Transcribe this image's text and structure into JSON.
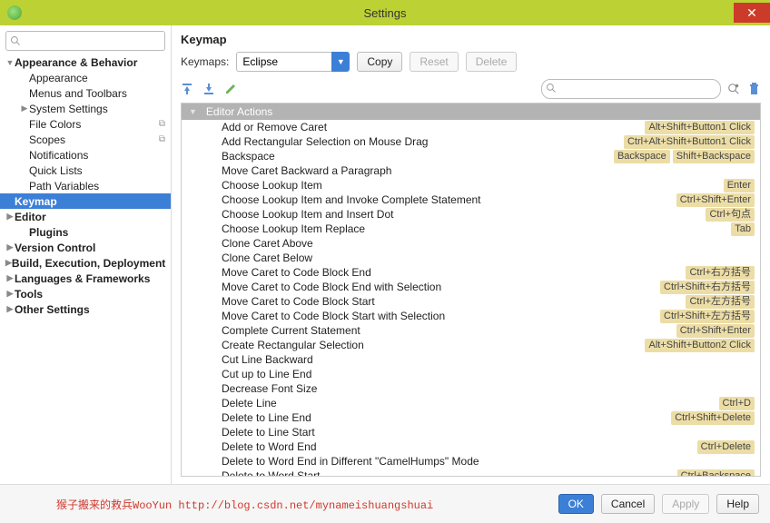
{
  "window": {
    "title": "Settings"
  },
  "sidebar": {
    "items": [
      {
        "label": "Appearance & Behavior",
        "bold": true,
        "level": 0,
        "expand": "open"
      },
      {
        "label": "Appearance",
        "level": 1
      },
      {
        "label": "Menus and Toolbars",
        "level": 1
      },
      {
        "label": "System Settings",
        "level": 1,
        "expand": "closed"
      },
      {
        "label": "File Colors",
        "level": 1,
        "mark": "⧉"
      },
      {
        "label": "Scopes",
        "level": 1,
        "mark": "⧉"
      },
      {
        "label": "Notifications",
        "level": 1
      },
      {
        "label": "Quick Lists",
        "level": 1
      },
      {
        "label": "Path Variables",
        "level": 1
      },
      {
        "label": "Keymap",
        "bold": true,
        "level": 0,
        "selected": true
      },
      {
        "label": "Editor",
        "bold": true,
        "level": 0,
        "expand": "closed"
      },
      {
        "label": "Plugins",
        "bold": true,
        "level": 1
      },
      {
        "label": "Version Control",
        "bold": true,
        "level": 0,
        "expand": "closed"
      },
      {
        "label": "Build, Execution, Deployment",
        "bold": true,
        "level": 0,
        "expand": "closed"
      },
      {
        "label": "Languages & Frameworks",
        "bold": true,
        "level": 0,
        "expand": "closed"
      },
      {
        "label": "Tools",
        "bold": true,
        "level": 0,
        "expand": "closed"
      },
      {
        "label": "Other Settings",
        "bold": true,
        "level": 0,
        "expand": "closed"
      }
    ]
  },
  "panel": {
    "title": "Keymap",
    "keymaps_label": "Keymaps:",
    "selected_keymap": "Eclipse",
    "copy_label": "Copy",
    "reset_label": "Reset",
    "delete_label": "Delete",
    "section_header": "Editor Actions",
    "actions": [
      {
        "name": "Add or Remove Caret",
        "shortcuts": [
          "Alt+Shift+Button1 Click"
        ]
      },
      {
        "name": "Add Rectangular Selection on Mouse Drag",
        "shortcuts": [
          "Ctrl+Alt+Shift+Button1 Click"
        ]
      },
      {
        "name": "Backspace",
        "shortcuts": [
          "Backspace",
          "Shift+Backspace"
        ]
      },
      {
        "name": "Move Caret Backward a Paragraph",
        "shortcuts": []
      },
      {
        "name": "Choose Lookup Item",
        "shortcuts": [
          "Enter"
        ]
      },
      {
        "name": "Choose Lookup Item and Invoke Complete Statement",
        "shortcuts": [
          "Ctrl+Shift+Enter"
        ]
      },
      {
        "name": "Choose Lookup Item and Insert Dot",
        "shortcuts": [
          "Ctrl+句点"
        ]
      },
      {
        "name": "Choose Lookup Item Replace",
        "shortcuts": [
          "Tab"
        ]
      },
      {
        "name": "Clone Caret Above",
        "shortcuts": []
      },
      {
        "name": "Clone Caret Below",
        "shortcuts": []
      },
      {
        "name": "Move Caret to Code Block End",
        "shortcuts": [
          "Ctrl+右方括号"
        ]
      },
      {
        "name": "Move Caret to Code Block End with Selection",
        "shortcuts": [
          "Ctrl+Shift+右方括号"
        ]
      },
      {
        "name": "Move Caret to Code Block Start",
        "shortcuts": [
          "Ctrl+左方括号"
        ]
      },
      {
        "name": "Move Caret to Code Block Start with Selection",
        "shortcuts": [
          "Ctrl+Shift+左方括号"
        ]
      },
      {
        "name": "Complete Current Statement",
        "shortcuts": [
          "Ctrl+Shift+Enter"
        ]
      },
      {
        "name": "Create Rectangular Selection",
        "shortcuts": [
          "Alt+Shift+Button2 Click"
        ]
      },
      {
        "name": "Cut Line Backward",
        "shortcuts": []
      },
      {
        "name": "Cut up to Line End",
        "shortcuts": []
      },
      {
        "name": "Decrease Font Size",
        "shortcuts": []
      },
      {
        "name": "Delete Line",
        "shortcuts": [
          "Ctrl+D"
        ]
      },
      {
        "name": "Delete to Line End",
        "shortcuts": [
          "Ctrl+Shift+Delete"
        ]
      },
      {
        "name": "Delete to Line Start",
        "shortcuts": []
      },
      {
        "name": "Delete to Word End",
        "shortcuts": [
          "Ctrl+Delete"
        ]
      },
      {
        "name": "Delete to Word End in Different \"CamelHumps\" Mode",
        "shortcuts": []
      },
      {
        "name": "Delete to Word Start",
        "shortcuts": [
          "Ctrl+Backspace"
        ]
      }
    ]
  },
  "footer": {
    "watermark": "猴子搬来的救兵WooYun http://blog.csdn.net/mynameishuangshuai",
    "ok": "OK",
    "cancel": "Cancel",
    "apply": "Apply",
    "help": "Help"
  }
}
